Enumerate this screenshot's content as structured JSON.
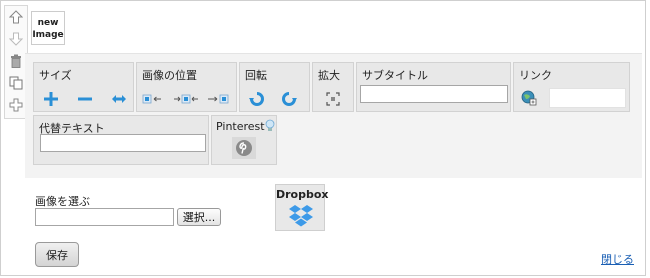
{
  "thumbnail": {
    "line1": "new",
    "line2": "Image"
  },
  "sidebar": {
    "icons": [
      "arrow-up-icon",
      "arrow-down-icon",
      "trash-icon",
      "copy-icon",
      "add-icon"
    ]
  },
  "panels": {
    "size": {
      "title": "サイズ"
    },
    "position": {
      "title": "画像の位置"
    },
    "rotate": {
      "title": "回転"
    },
    "zoom": {
      "title": "拡大"
    },
    "subtitle": {
      "title": "サブタイトル",
      "value": ""
    },
    "link": {
      "title": "リンク",
      "value": ""
    },
    "alt": {
      "title": "代替テキスト",
      "value": ""
    },
    "pinterest": {
      "title": "Pinterest"
    }
  },
  "upload": {
    "label": "画像を選ぶ",
    "value": "",
    "select_label": "選択..."
  },
  "dropbox": {
    "label": "Dropbox"
  },
  "footer": {
    "save_label": "保存",
    "close_label": "閉じる"
  },
  "colors": {
    "accent_blue": "#2a8fd6",
    "link": "#1a5fb4",
    "panel_bg": "#e8e8e8"
  }
}
